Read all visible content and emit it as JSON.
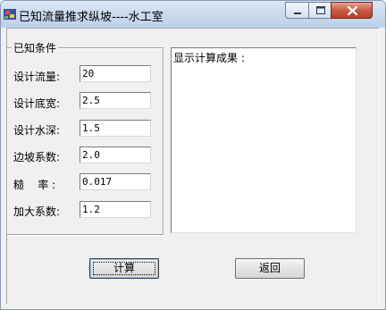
{
  "window": {
    "title": "已知流量推求纵坡----水工室"
  },
  "form": {
    "group_title": "已知条件",
    "fields": [
      {
        "label": "设计流量:",
        "value": "20"
      },
      {
        "label": "设计底宽:",
        "value": "2.5"
      },
      {
        "label": "设计水深:",
        "value": "1.5"
      },
      {
        "label": "边坡系数:",
        "value": "2.0"
      },
      {
        "label": "糙    率 :",
        "value": "0.017"
      },
      {
        "label": "加大系数:",
        "value": "1.2"
      }
    ]
  },
  "result": {
    "text": "显示计算成果 :"
  },
  "buttons": {
    "calculate_label": "计算",
    "back_label": "返回"
  },
  "icons": {
    "app": "app-icon",
    "minimize": "minimize-icon",
    "maximize": "maximize-icon",
    "close": "close-icon"
  },
  "colors": {
    "close_button": "#c75a44",
    "window_bg": "#f0f0f0",
    "titlebar": "#c9d9ec"
  }
}
